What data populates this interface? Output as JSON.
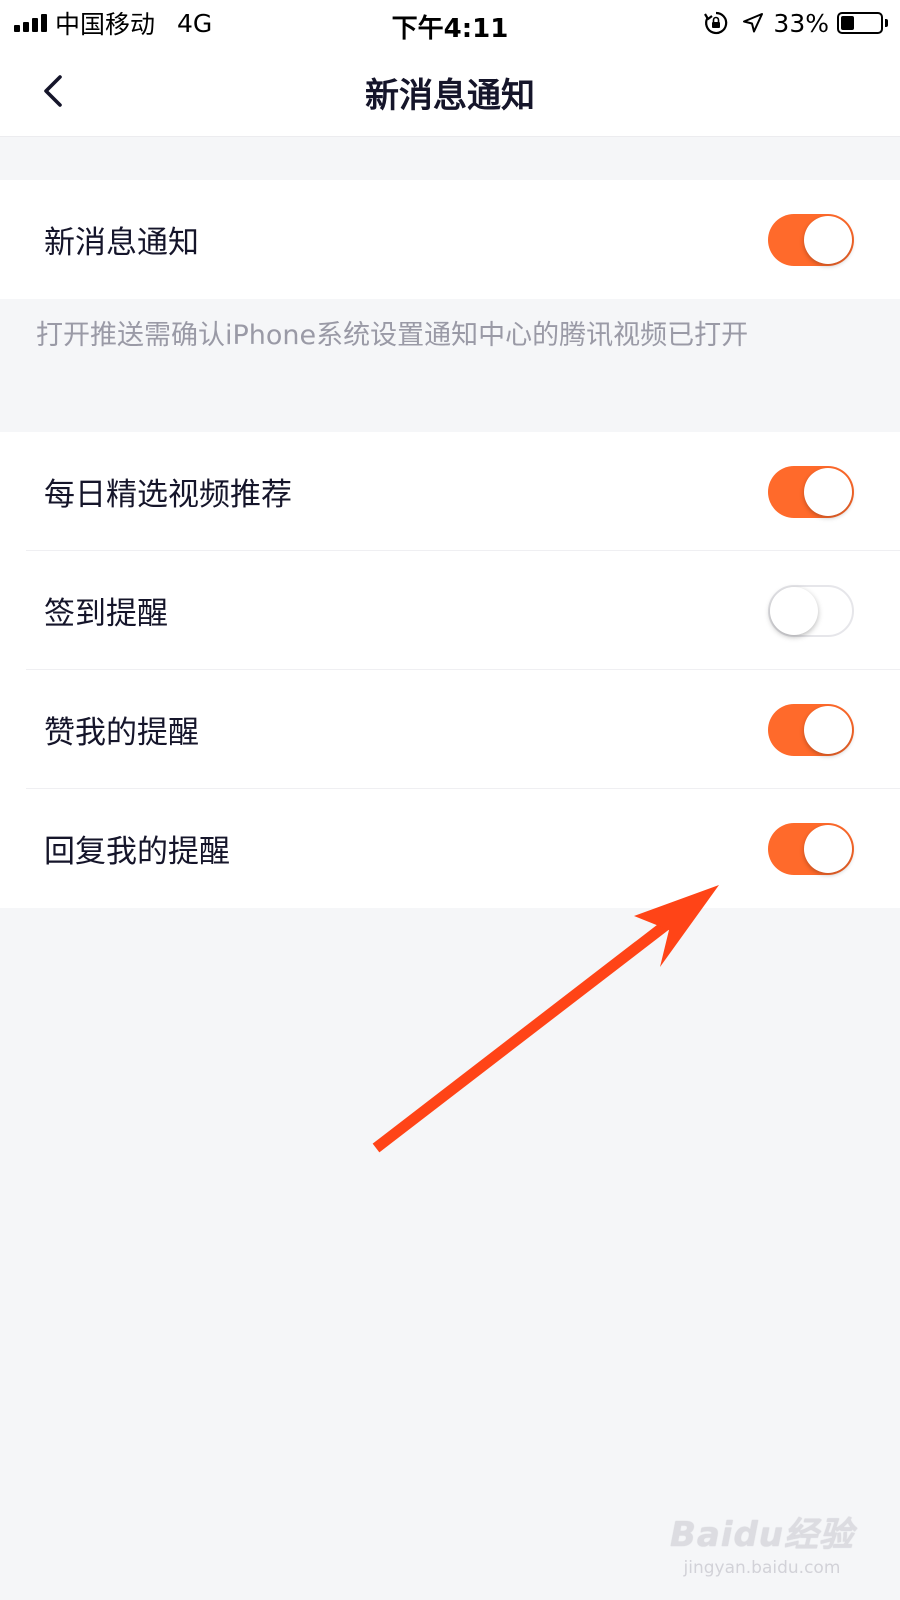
{
  "status_bar": {
    "carrier": "中国移动",
    "network": "4G",
    "time": "下午4:11",
    "battery_percent": "33%",
    "battery_level": 0.33,
    "icons": [
      "signal-icon",
      "rotation-lock-icon",
      "location-arrow-icon",
      "battery-icon"
    ]
  },
  "nav": {
    "title": "新消息通知",
    "back_icon": "chevron-left-icon"
  },
  "main_setting": {
    "label": "新消息通知",
    "enabled": true
  },
  "hint": "打开推送需确认iPhone系统设置通知中心的腾讯视频已打开",
  "notification_settings": [
    {
      "label": "每日精选视频推荐",
      "enabled": true
    },
    {
      "label": "签到提醒",
      "enabled": false
    },
    {
      "label": "赞我的提醒",
      "enabled": true
    },
    {
      "label": "回复我的提醒",
      "enabled": true
    }
  ],
  "colors": {
    "toggle_on": "#ff6a2b",
    "background": "#f5f6f8",
    "annotation_arrow": "#ff4417"
  },
  "watermark": {
    "logo": "Baidu经验",
    "url": "jingyan.baidu.com"
  }
}
